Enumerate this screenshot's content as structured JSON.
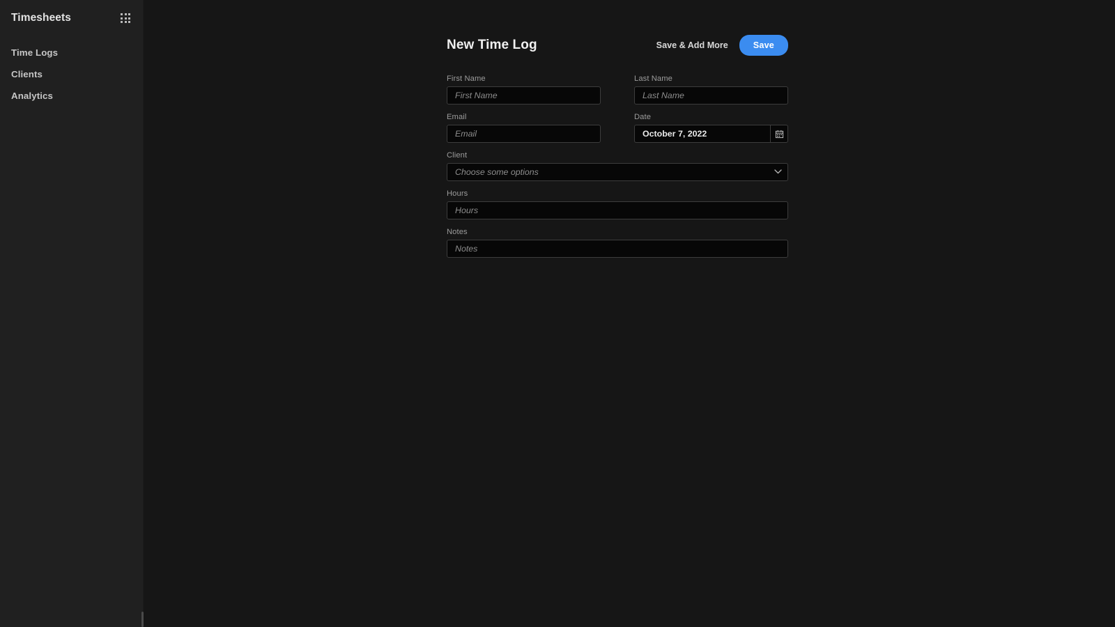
{
  "sidebar": {
    "title": "Timesheets",
    "apps_icon": "grid-apps-icon",
    "items": [
      {
        "label": "Time Logs"
      },
      {
        "label": "Clients"
      },
      {
        "label": "Analytics"
      }
    ]
  },
  "header": {
    "title": "New Time Log",
    "save_and_add_more_label": "Save & Add More",
    "save_label": "Save",
    "accent_color": "#3b8cf0"
  },
  "form": {
    "first_name": {
      "label": "First Name",
      "placeholder": "First Name",
      "value": ""
    },
    "last_name": {
      "label": "Last Name",
      "placeholder": "Last Name",
      "value": ""
    },
    "email": {
      "label": "Email",
      "placeholder": "Email",
      "value": ""
    },
    "date": {
      "label": "Date",
      "value": "October 7, 2022",
      "icon": "calendar-icon"
    },
    "client": {
      "label": "Client",
      "placeholder": "Choose some options",
      "value": "",
      "icon": "chevron-down-icon"
    },
    "hours": {
      "label": "Hours",
      "placeholder": "Hours",
      "value": ""
    },
    "notes": {
      "label": "Notes",
      "placeholder": "Notes",
      "value": ""
    }
  },
  "theme": {
    "sidebar_bg": "#202020",
    "main_bg": "#161616",
    "field_bg": "#070707",
    "field_border": "#3d3d3d",
    "label_color": "#9c9c9c"
  }
}
